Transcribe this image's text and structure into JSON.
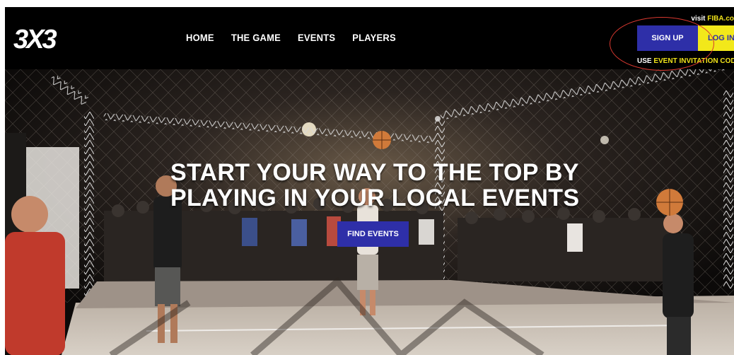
{
  "header": {
    "logo_text": "3X3",
    "nav": [
      {
        "label": "HOME"
      },
      {
        "label": "THE GAME"
      },
      {
        "label": "EVENTS"
      },
      {
        "label": "PLAYERS"
      }
    ],
    "visit_prefix": "visit ",
    "visit_link": "FIBA.co",
    "signup_label": "SIGN UP",
    "login_label": "LOG IN",
    "invite_prefix": "USE ",
    "invite_link": "EVENT INVITATION COD"
  },
  "hero": {
    "headline_line1": "START YOUR WAY TO THE TOP BY",
    "headline_line2": "PLAYING IN YOUR LOCAL EVENTS",
    "cta_label": "FIND EVENTS"
  },
  "colors": {
    "brand_blue": "#2e2fa8",
    "brand_yellow": "#f2e81a",
    "annotation_red": "#d8382f",
    "header_bg": "#000000"
  },
  "icons": {
    "logo": "3x3-logo"
  }
}
